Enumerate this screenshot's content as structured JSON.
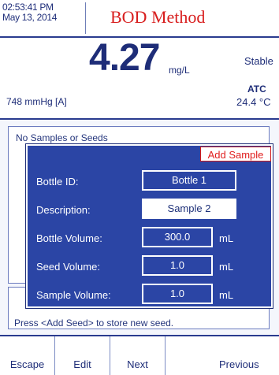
{
  "header": {
    "time": "02:53:41 PM",
    "date": "May 13, 2014",
    "title": "BOD Method"
  },
  "reading": {
    "value": "4.27",
    "unit": "mg/L",
    "status": "Stable",
    "pressure": "748 mmHg  [A]",
    "compensation": "ATC",
    "temperature": "24.4 °C"
  },
  "panel": {
    "empty_message": "No Samples or Seeds",
    "hint": "Press <Add Seed> to store new seed."
  },
  "dialog": {
    "title": "Add Sample",
    "fields": {
      "bottle_id": {
        "label": "Bottle ID:",
        "value": "Bottle 1"
      },
      "description": {
        "label": "Description:",
        "value": "Sample 2"
      },
      "bottle_volume": {
        "label": "Bottle Volume:",
        "value": "300.0",
        "unit": "mL"
      },
      "seed_volume": {
        "label": "Seed Volume:",
        "value": "1.0",
        "unit": "mL"
      },
      "sample_volume": {
        "label": "Sample Volume:",
        "value": "1.0",
        "unit": "mL"
      }
    }
  },
  "softkeys": {
    "escape": "Escape",
    "edit": "Edit",
    "next": "Next",
    "previous": "Previous"
  },
  "colors": {
    "dialog_bg": "#2b45a5",
    "title_red": "#d81e1e",
    "text_navy": "#1e2d78"
  }
}
